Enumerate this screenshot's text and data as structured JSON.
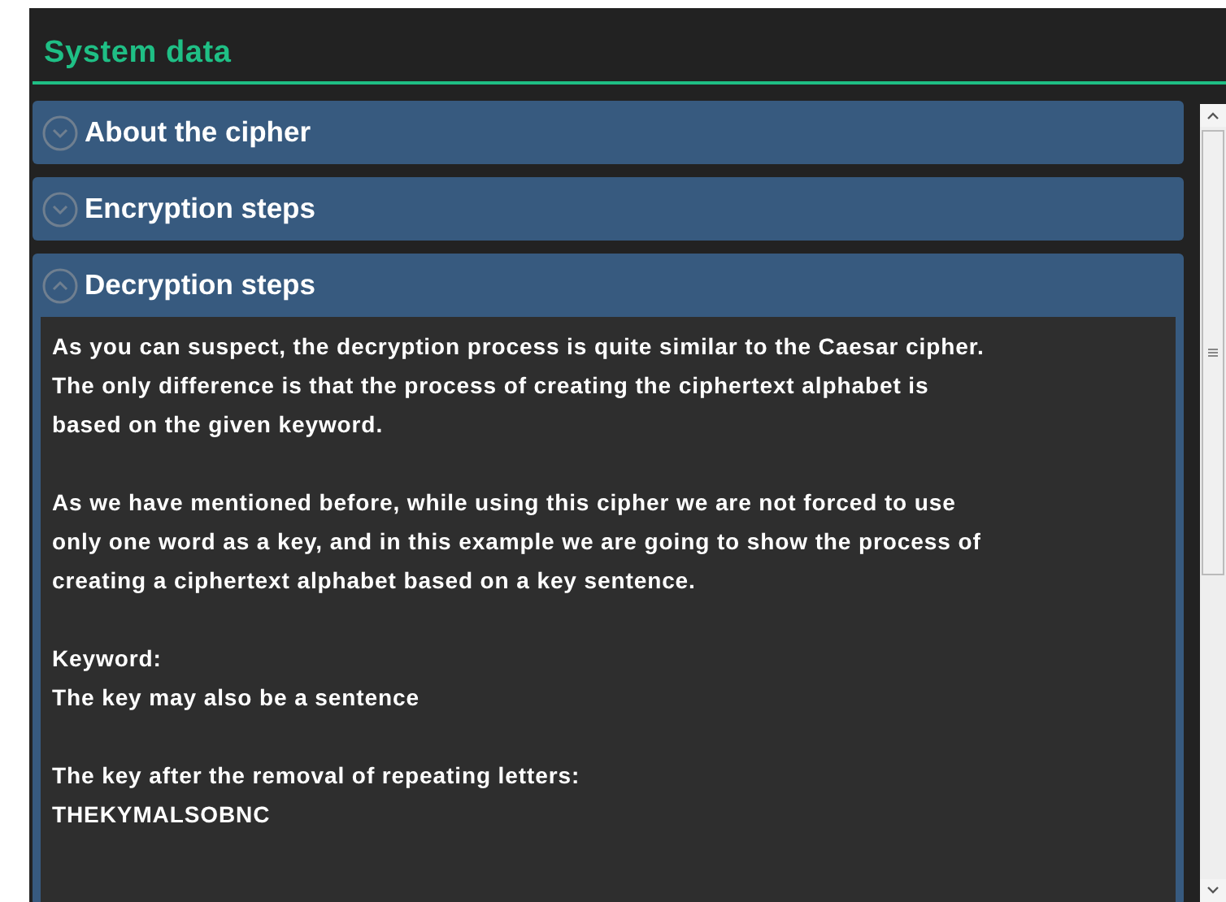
{
  "panel": {
    "title": "System data"
  },
  "sections": [
    {
      "title": "About the cipher",
      "expanded": false
    },
    {
      "title": "Encryption steps",
      "expanded": false
    },
    {
      "title": "Decryption steps",
      "expanded": true,
      "paragraphs": [
        {
          "lines": [
            "As you can suspect, the decryption process is quite similar to the Caesar cipher.",
            "The only difference is that the process of creating the ciphertext alphabet is",
            "based on the given keyword."
          ]
        },
        {
          "lines": [
            "As we have mentioned before, while using this cipher we are not forced to use",
            "only one word as a key, and in this example we are going to show the process of",
            "creating a ciphertext alphabet based on a key sentence."
          ]
        },
        {
          "lines": [
            "Keyword:",
            "The key may also be a sentence"
          ]
        },
        {
          "lines": [
            "The key after the removal of repeating letters:",
            "THEKYMALSOBNC"
          ]
        }
      ]
    }
  ]
}
